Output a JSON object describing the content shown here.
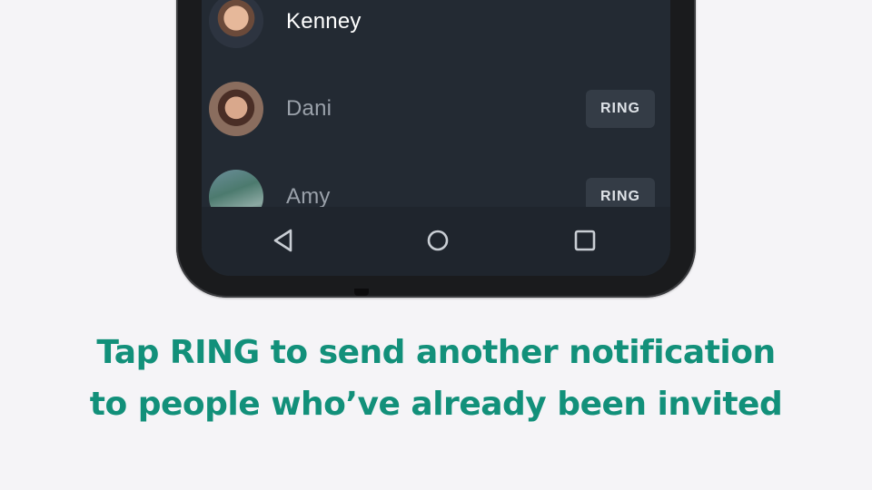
{
  "contacts": [
    {
      "name": "Kenney",
      "avatar": "kenney-avatar",
      "ring_label": ""
    },
    {
      "name": "Dani",
      "avatar": "dani-avatar",
      "ring_label": "RING"
    },
    {
      "name": "Amy",
      "avatar": "amy-avatar",
      "ring_label": "RING"
    }
  ],
  "navbar": {
    "back_icon": "back-triangle-icon",
    "home_icon": "home-circle-icon",
    "recents_icon": "recents-square-icon"
  },
  "caption": {
    "line1": "Tap RING to send another notification",
    "line2": "to people who’ve already been invited"
  },
  "colors": {
    "caption": "#12907a",
    "screen_bg": "#232a33",
    "ring_bg": "#343c46"
  }
}
